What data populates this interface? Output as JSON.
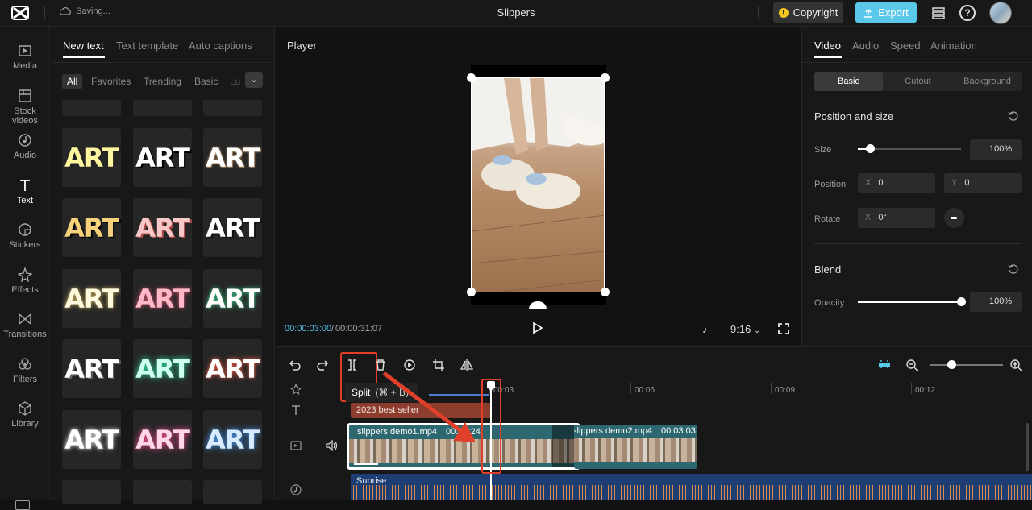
{
  "header": {
    "status": "Saving...",
    "title": "Slippers",
    "copyright_label": "Copyright",
    "export_label": "Export"
  },
  "nav": {
    "items": [
      {
        "label": "Media"
      },
      {
        "label": "Stock videos"
      },
      {
        "label": "Audio"
      },
      {
        "label": "Text"
      },
      {
        "label": "Stickers"
      },
      {
        "label": "Effects"
      },
      {
        "label": "Transitions"
      },
      {
        "label": "Filters"
      },
      {
        "label": "Library"
      }
    ],
    "active": "Text"
  },
  "text_panel": {
    "tabs": [
      "New text",
      "Text template",
      "Auto captions"
    ],
    "chips": [
      "All",
      "Favorites",
      "Trending",
      "Basic",
      "Lu"
    ],
    "cards": [
      "ART",
      "ART",
      "ART",
      "ART",
      "ART",
      "ART",
      "ART",
      "ART",
      "ART",
      "ART",
      "ART",
      "ART",
      "ART",
      "ART",
      "ART"
    ]
  },
  "player": {
    "label": "Player",
    "current_time": "00:00:03:00",
    "separator": "/",
    "total_time": "00:00:31:07",
    "ratio": "9:16"
  },
  "props": {
    "tabs": [
      "Video",
      "Audio",
      "Speed",
      "Animation"
    ],
    "segments": [
      "Basic",
      "Cutout",
      "Background"
    ],
    "position_section": "Position and size",
    "size_label": "Size",
    "size_value": "100%",
    "size_level": 0.12,
    "position_label": "Position",
    "pos_x_prefix": "X",
    "pos_x": "0",
    "pos_y_prefix": "Y",
    "pos_y": "0",
    "rotate_label": "Rotate",
    "rot_x_prefix": "X",
    "rotate_value": "0°",
    "blend_section": "Blend",
    "opacity_label": "Opacity",
    "opacity_value": "100%",
    "opacity_level": 1.0
  },
  "timeline": {
    "tooltip_label": "Split",
    "tooltip_shortcut": "(⌘ + B)",
    "ticks": [
      "00:03",
      "00:06",
      "00:09",
      "00:12"
    ],
    "text_clip": "2023 best seller",
    "clip1_name": "slippers demo1.mp4",
    "clip1_dur": "00:04:24",
    "clip2_name": "slippers demo2.mp4",
    "clip2_dur": "00:03:03",
    "audio_name": "Sunrise"
  }
}
